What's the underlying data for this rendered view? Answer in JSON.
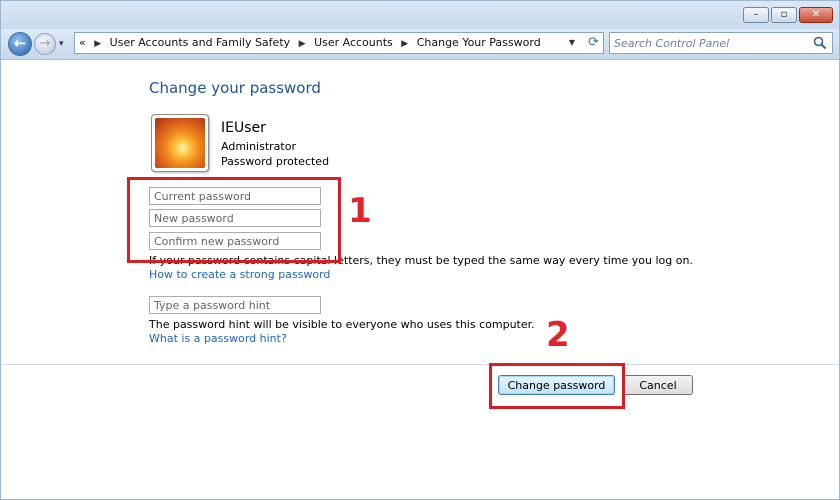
{
  "window": {
    "controls": [
      "minimize",
      "maximize",
      "close"
    ]
  },
  "navigation": {
    "recent_glyph": "▾",
    "breadcrumb_prefix": "«",
    "breadcrumbs": [
      "User Accounts and Family Safety",
      "User Accounts",
      "Change Your Password"
    ],
    "search_placeholder": "Search Control Panel"
  },
  "page": {
    "heading": "Change your password",
    "user": {
      "name": "IEUser",
      "role": "Administrator",
      "status": "Password protected"
    },
    "fields": {
      "current_placeholder": "Current password",
      "new_placeholder": "New password",
      "confirm_placeholder": "Confirm new password",
      "hint_placeholder": "Type a password hint"
    },
    "capital_note": "If your password contains capital letters, they must be typed the same way every time you log on.",
    "strong_link": "How to create a strong password",
    "hint_note": "The password hint will be visible to everyone who uses this computer.",
    "hint_link": "What is a password hint?",
    "buttons": {
      "change": "Change password",
      "cancel": "Cancel"
    }
  },
  "annotations": {
    "step1": "1",
    "step2": "2",
    "color": "#d31f26"
  },
  "colors": {
    "heading": "#1e5494",
    "link": "#1f65b8",
    "chrome": "#c9daee"
  }
}
